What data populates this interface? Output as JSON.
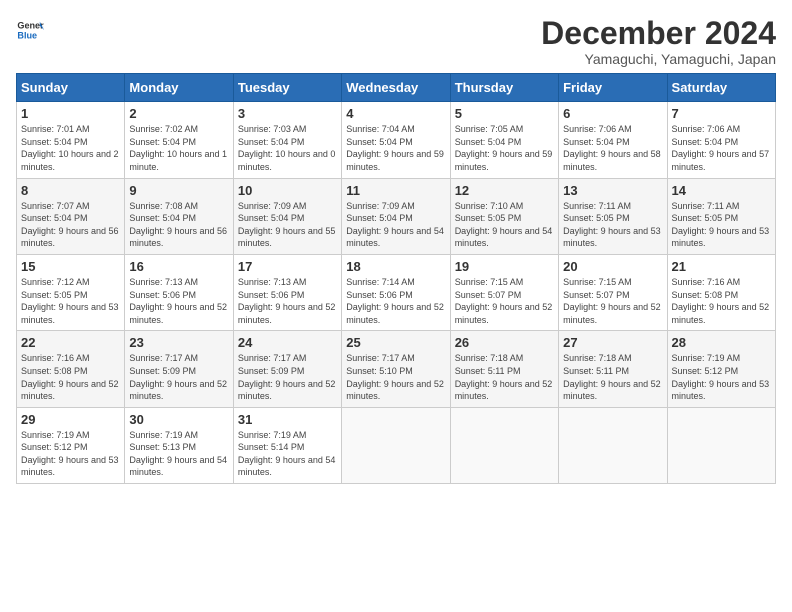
{
  "header": {
    "logo_general": "General",
    "logo_blue": "Blue",
    "title": "December 2024",
    "subtitle": "Yamaguchi, Yamaguchi, Japan"
  },
  "calendar": {
    "days_of_week": [
      "Sunday",
      "Monday",
      "Tuesday",
      "Wednesday",
      "Thursday",
      "Friday",
      "Saturday"
    ],
    "weeks": [
      [
        {
          "day": "1",
          "sunrise": "7:01 AM",
          "sunset": "5:04 PM",
          "daylight": "10 hours and 2 minutes."
        },
        {
          "day": "2",
          "sunrise": "7:02 AM",
          "sunset": "5:04 PM",
          "daylight": "10 hours and 1 minute."
        },
        {
          "day": "3",
          "sunrise": "7:03 AM",
          "sunset": "5:04 PM",
          "daylight": "10 hours and 0 minutes."
        },
        {
          "day": "4",
          "sunrise": "7:04 AM",
          "sunset": "5:04 PM",
          "daylight": "9 hours and 59 minutes."
        },
        {
          "day": "5",
          "sunrise": "7:05 AM",
          "sunset": "5:04 PM",
          "daylight": "9 hours and 59 minutes."
        },
        {
          "day": "6",
          "sunrise": "7:06 AM",
          "sunset": "5:04 PM",
          "daylight": "9 hours and 58 minutes."
        },
        {
          "day": "7",
          "sunrise": "7:06 AM",
          "sunset": "5:04 PM",
          "daylight": "9 hours and 57 minutes."
        }
      ],
      [
        {
          "day": "8",
          "sunrise": "7:07 AM",
          "sunset": "5:04 PM",
          "daylight": "9 hours and 56 minutes."
        },
        {
          "day": "9",
          "sunrise": "7:08 AM",
          "sunset": "5:04 PM",
          "daylight": "9 hours and 56 minutes."
        },
        {
          "day": "10",
          "sunrise": "7:09 AM",
          "sunset": "5:04 PM",
          "daylight": "9 hours and 55 minutes."
        },
        {
          "day": "11",
          "sunrise": "7:09 AM",
          "sunset": "5:04 PM",
          "daylight": "9 hours and 54 minutes."
        },
        {
          "day": "12",
          "sunrise": "7:10 AM",
          "sunset": "5:05 PM",
          "daylight": "9 hours and 54 minutes."
        },
        {
          "day": "13",
          "sunrise": "7:11 AM",
          "sunset": "5:05 PM",
          "daylight": "9 hours and 53 minutes."
        },
        {
          "day": "14",
          "sunrise": "7:11 AM",
          "sunset": "5:05 PM",
          "daylight": "9 hours and 53 minutes."
        }
      ],
      [
        {
          "day": "15",
          "sunrise": "7:12 AM",
          "sunset": "5:05 PM",
          "daylight": "9 hours and 53 minutes."
        },
        {
          "day": "16",
          "sunrise": "7:13 AM",
          "sunset": "5:06 PM",
          "daylight": "9 hours and 52 minutes."
        },
        {
          "day": "17",
          "sunrise": "7:13 AM",
          "sunset": "5:06 PM",
          "daylight": "9 hours and 52 minutes."
        },
        {
          "day": "18",
          "sunrise": "7:14 AM",
          "sunset": "5:06 PM",
          "daylight": "9 hours and 52 minutes."
        },
        {
          "day": "19",
          "sunrise": "7:15 AM",
          "sunset": "5:07 PM",
          "daylight": "9 hours and 52 minutes."
        },
        {
          "day": "20",
          "sunrise": "7:15 AM",
          "sunset": "5:07 PM",
          "daylight": "9 hours and 52 minutes."
        },
        {
          "day": "21",
          "sunrise": "7:16 AM",
          "sunset": "5:08 PM",
          "daylight": "9 hours and 52 minutes."
        }
      ],
      [
        {
          "day": "22",
          "sunrise": "7:16 AM",
          "sunset": "5:08 PM",
          "daylight": "9 hours and 52 minutes."
        },
        {
          "day": "23",
          "sunrise": "7:17 AM",
          "sunset": "5:09 PM",
          "daylight": "9 hours and 52 minutes."
        },
        {
          "day": "24",
          "sunrise": "7:17 AM",
          "sunset": "5:09 PM",
          "daylight": "9 hours and 52 minutes."
        },
        {
          "day": "25",
          "sunrise": "7:17 AM",
          "sunset": "5:10 PM",
          "daylight": "9 hours and 52 minutes."
        },
        {
          "day": "26",
          "sunrise": "7:18 AM",
          "sunset": "5:11 PM",
          "daylight": "9 hours and 52 minutes."
        },
        {
          "day": "27",
          "sunrise": "7:18 AM",
          "sunset": "5:11 PM",
          "daylight": "9 hours and 52 minutes."
        },
        {
          "day": "28",
          "sunrise": "7:19 AM",
          "sunset": "5:12 PM",
          "daylight": "9 hours and 53 minutes."
        }
      ],
      [
        {
          "day": "29",
          "sunrise": "7:19 AM",
          "sunset": "5:12 PM",
          "daylight": "9 hours and 53 minutes."
        },
        {
          "day": "30",
          "sunrise": "7:19 AM",
          "sunset": "5:13 PM",
          "daylight": "9 hours and 54 minutes."
        },
        {
          "day": "31",
          "sunrise": "7:19 AM",
          "sunset": "5:14 PM",
          "daylight": "9 hours and 54 minutes."
        },
        null,
        null,
        null,
        null
      ]
    ]
  }
}
